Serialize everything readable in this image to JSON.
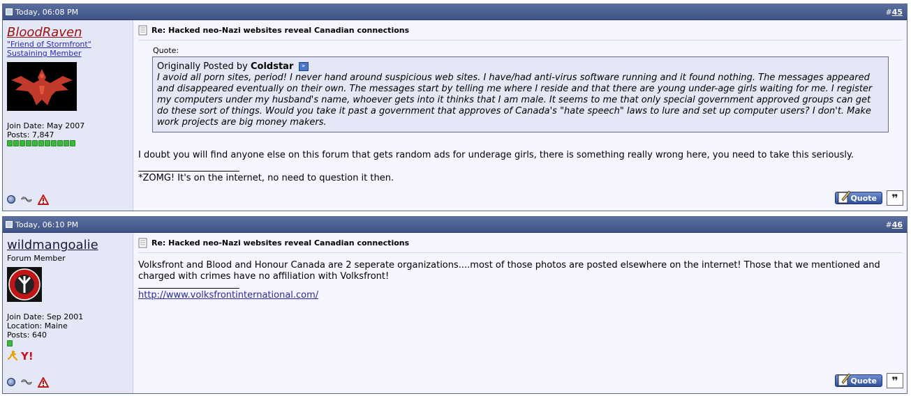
{
  "posts": [
    {
      "date": "Today, 06:08 PM",
      "post_number_prefix": "#",
      "post_number": "45",
      "username": "BloodRaven",
      "user_title_link": "\"Friend of Stormfront\"",
      "user_rank": "Sustaining Member",
      "join_date": "Join Date: May 2007",
      "posts": "Posts: 7,847",
      "reputation_pips": 11,
      "title": "Re: Hacked neo-Nazi websites reveal Canadian connections",
      "quote_label": "Quote:",
      "quote_by_prefix": "Originally Posted by",
      "quote_author": "Coldstar",
      "quote_text": "I avoid all porn sites, period! I never hand around suspicious web sites. I have/had anti-virus software running and it found nothing. The messages appeared and disappeared eventually on their own. The messages start by telling me where I reside and that there are young under-age girls waiting for me. I register my computers under my husband's name, whoever gets into it thinks that I am male. It seems to me that only special government approved groups can get do these sort of things. Would you take it past a government that approves of Canada's \"hate speech\" laws to lure and set up computer users? I don't. Make work projects are big money makers.",
      "message": "I doubt you will find anyone else on this forum that gets random ads for underage girls, there is something really wrong here, you need to take this seriously.",
      "signature": "*ZOMG! It's on the internet, no need to question it then.",
      "quote_button": "Quote"
    },
    {
      "date": "Today, 06:10 PM",
      "post_number_prefix": "#",
      "post_number": "46",
      "username": "wildmangoalie",
      "user_rank": "Forum Member",
      "join_date": "Join Date: Sep 2001",
      "location": "Location: Maine",
      "posts": "Posts: 640",
      "reputation_pips": 1,
      "title": "Re: Hacked neo-Nazi websites reveal Canadian connections",
      "message": "Volksfront and Blood and Honour Canada are 2 seperate organizations....most of those photos are posted elsewhere on the internet! Those that we mentioned and charged with crimes have no affiliation with Volksfront!",
      "signature_link": "http://www.volksfrontinternational.com/",
      "quote_button": "Quote"
    }
  ],
  "colors": {
    "header_bg": "#3e5285",
    "userinfo_bg": "#e4e7f5",
    "content_bg": "#f5f5ff",
    "username_red": "#9b1212",
    "rep_green": "#3cb83c"
  }
}
